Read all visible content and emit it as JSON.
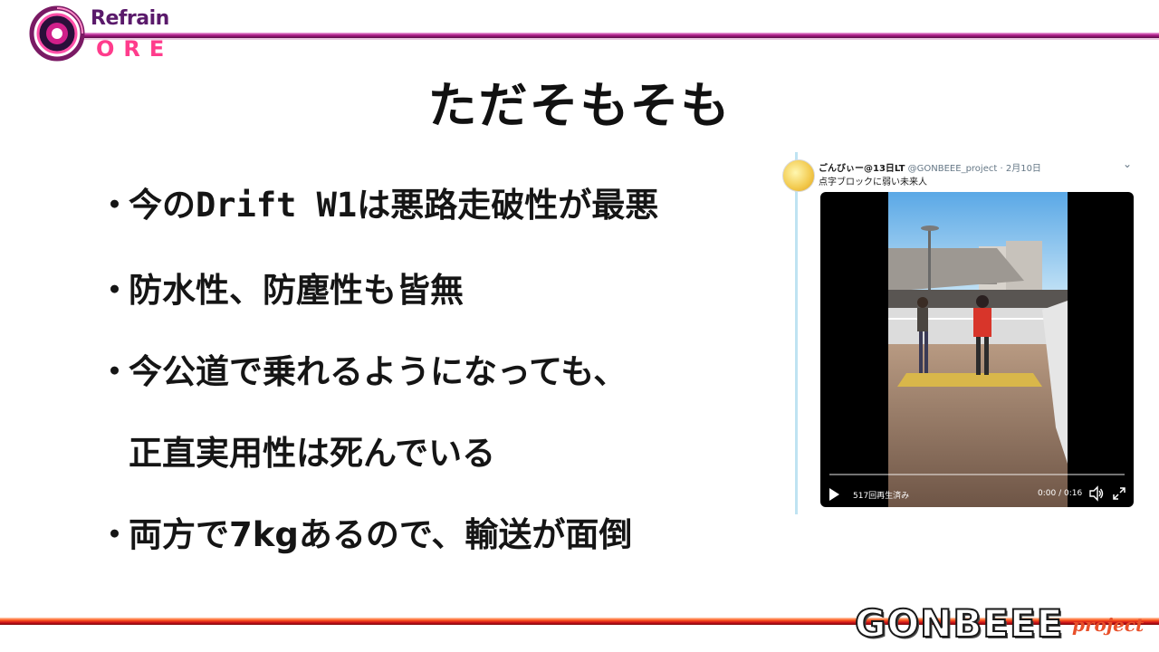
{
  "logo": {
    "top_line": "Refrain",
    "bottom_line": "CORE",
    "bottom_line_visible": "ORE"
  },
  "slide": {
    "title": "ただそもそも",
    "bullet_marker": "・",
    "bullets": [
      {
        "prefix": "今の",
        "mono": "Drift W1",
        "suffix": "は悪路走破性が最悪"
      },
      {
        "text": "防水性、防塵性も皆無"
      },
      {
        "text": "今公道で乗れるようになっても、",
        "continuation": "正直実用性は死んでいる"
      },
      {
        "text": "両方で7kgあるので、輸送が面倒"
      }
    ]
  },
  "tweet": {
    "display_name": "ごんびぃー@13日LT",
    "handle": "@GONBEEE_project",
    "date": "2月10日",
    "separator": "·",
    "text": "点字ブロックに弱い未来人",
    "video": {
      "views": "517回再生済み",
      "time": "0:00 / 0:16",
      "progress": 0
    },
    "icons": [
      "chevron-down-icon",
      "play-icon",
      "volume-icon",
      "fullscreen-icon"
    ]
  },
  "footer_logo": {
    "main": "GONBEEE",
    "sub": "project"
  },
  "colors": {
    "top_stripe": "#b01f8c",
    "bottom_stripe": "#ff5a1e",
    "title_text": "#111111",
    "logo_core": "#ff3c8c",
    "logo_sub": "#e8502a"
  }
}
